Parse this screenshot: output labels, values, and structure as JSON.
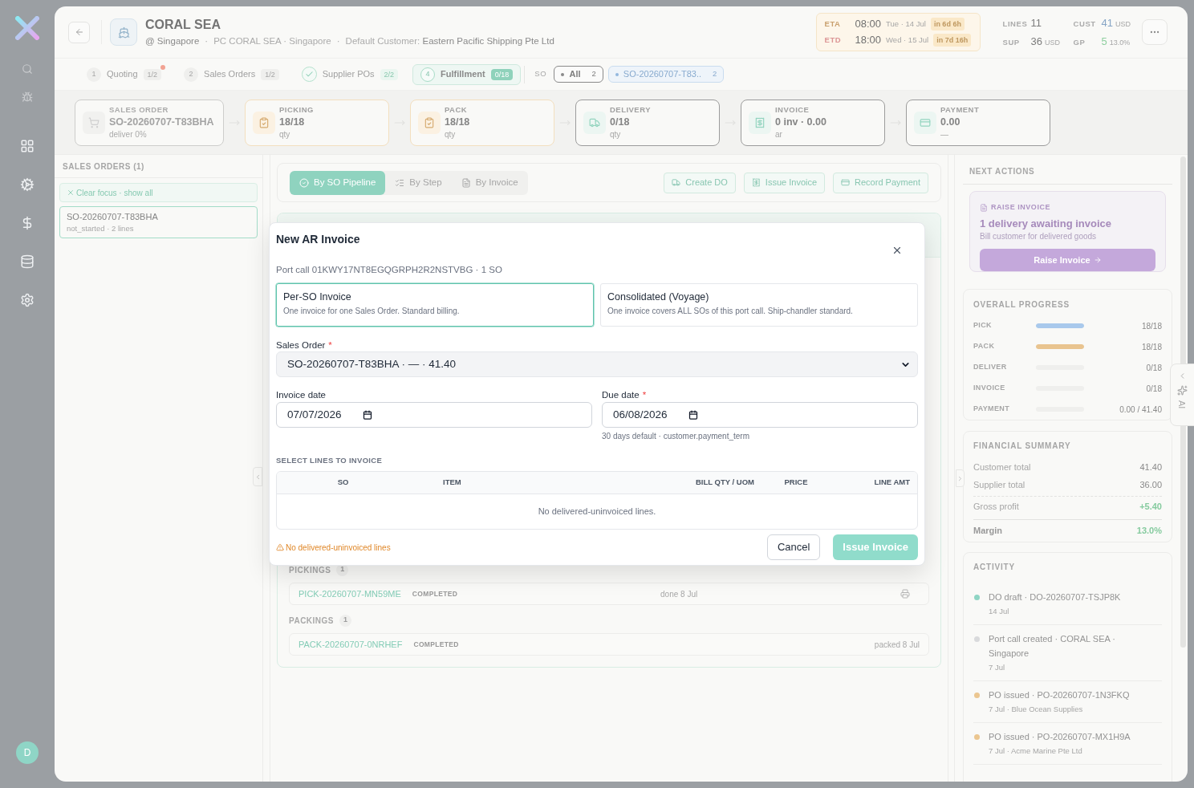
{
  "sidebar": {
    "avatar": "D"
  },
  "header": {
    "title": "CORAL SEA",
    "meta": [
      "@ Singapore",
      "PC CORAL SEA · Singapore"
    ],
    "separator": "·",
    "customer_label": "Default Customer:",
    "customer": "Eastern Pacific Shipping Pte Ltd"
  },
  "schedule": [
    {
      "kind": "eta",
      "label": "ETA",
      "time": "08:00",
      "date": "Tue · 14 Jul",
      "countdown": "in 6d 6h"
    },
    {
      "kind": "etd",
      "label": "ETD",
      "time": "18:00",
      "date": "Wed · 15 Jul",
      "countdown": "in 7d 16h"
    }
  ],
  "stats": [
    {
      "kind": "count",
      "label": "LINES",
      "value": "11"
    },
    {
      "kind": "revenue",
      "label": "CUST",
      "value": "41",
      "unit": "USD"
    },
    {
      "kind": "cost",
      "label": "SUP",
      "value": "36",
      "unit": "USD"
    },
    {
      "kind": "profit",
      "label": "GP",
      "value": "5",
      "unit": "13.0%"
    }
  ],
  "steps": [
    {
      "number": "1",
      "label": "Quoting",
      "count": "1/2",
      "alert": true,
      "done": false,
      "selected": false
    },
    {
      "number": "2",
      "label": "Sales Orders",
      "count": "1/2",
      "alert": false,
      "done": false,
      "selected": false
    },
    {
      "label": "Supplier POs",
      "count": "2/2",
      "alert": false,
      "done": true,
      "selected": false
    },
    {
      "number": "4",
      "label": "Fulfillment",
      "count": "0/18",
      "alert": false,
      "done": false,
      "selected": true
    }
  ],
  "so_filter": {
    "label": "SO",
    "options": [
      {
        "label": "All",
        "count": "2",
        "selected": true
      },
      {
        "label": "SO-20260707-T83..",
        "count": "2",
        "selected": false
      }
    ]
  },
  "stages": [
    {
      "kind": "sales_order",
      "disabled": true,
      "done": false,
      "label": "SALES ORDER",
      "value": "SO-20260707-T83BHA",
      "sub": "deliver 0%"
    },
    {
      "kind": "picking",
      "disabled": false,
      "done": true,
      "label": "PICKING",
      "value": "18/18",
      "sub": "qty"
    },
    {
      "kind": "pack",
      "disabled": false,
      "done": true,
      "label": "PACK",
      "value": "18/18",
      "sub": "qty"
    },
    {
      "kind": "delivery",
      "disabled": false,
      "done": false,
      "label": "DELIVERY",
      "value": "0/18",
      "sub": "qty"
    },
    {
      "kind": "invoice",
      "disabled": false,
      "done": false,
      "label": "INVOICE",
      "value": "0 inv · 0.00",
      "sub": "ar"
    },
    {
      "kind": "payment",
      "disabled": false,
      "done": false,
      "label": "PAYMENT",
      "value": "0.00",
      "sub": "—"
    }
  ],
  "sales_orders": {
    "title": "SALES ORDERS (1)",
    "clear_focus": "Clear focus · show all",
    "items": [
      {
        "id": "SO-20260707-T83BHA",
        "meta": "not_started · 2 lines",
        "selected": true
      }
    ]
  },
  "views": [
    {
      "kind": "pipeline",
      "label": "By SO Pipeline",
      "selected": true
    },
    {
      "kind": "step",
      "label": "By Step",
      "selected": false
    },
    {
      "kind": "invoice",
      "label": "By Invoice",
      "selected": false
    }
  ],
  "actions": [
    {
      "kind": "delivery",
      "label": "Create DO"
    },
    {
      "kind": "invoice",
      "label": "Issue Invoice"
    },
    {
      "kind": "payment",
      "label": "Record Payment"
    }
  ],
  "pickings": {
    "title": "PICKINGS",
    "count": "1",
    "rows": [
      {
        "ref": "PICK-20260707-MN59ME",
        "status": "COMPLETED",
        "note": "done 8 Jul",
        "printable": true
      }
    ]
  },
  "packings": {
    "title": "PACKINGS",
    "count": "1",
    "rows": [
      {
        "ref": "PACK-20260707-0NRHEF",
        "status": "COMPLETED",
        "note": "packed 8 Jul",
        "printable": false
      }
    ]
  },
  "dialog": {
    "title": "New AR Invoice",
    "subtitle": "Port call 01KWY17NT8EGQGRPH2R2NSTVBG · 1 SO",
    "modes": [
      {
        "title": "Per-SO Invoice",
        "description": "One invoice for one Sales Order. Standard billing.",
        "selected": true
      },
      {
        "title": "Consolidated (Voyage)",
        "description": "One invoice covers ALL SOs of this port call. Ship-chandler standard.",
        "selected": false
      }
    ],
    "sales_order": {
      "label": "Sales Order",
      "required_mark": "*",
      "value": "SO-20260707-T83BHA · — · 41.40"
    },
    "invoice_date": {
      "label": "Invoice date",
      "value": "07/07/2026"
    },
    "due_date": {
      "label": "Due date",
      "required_mark": "*",
      "value": "06/08/2026",
      "hint": "30 days default · customer.payment_term"
    },
    "lines": {
      "title": "SELECT LINES TO INVOICE",
      "columns": [
        "SO",
        "ITEM",
        "BILL QTY / UOM",
        "PRICE",
        "LINE AMT"
      ],
      "empty": "No delivered-uninvoiced lines."
    },
    "warning": "No delivered-uninvoiced lines",
    "buttons": [
      {
        "kind": "cancel",
        "label": "Cancel",
        "disabled": false
      },
      {
        "kind": "primary",
        "label": "Issue Invoice",
        "disabled": true
      }
    ]
  },
  "next_actions": {
    "title": "NEXT ACTIONS",
    "tag": "RAISE INVOICE",
    "headline": "1 delivery awaiting invoice",
    "description": "Bill customer for delivered goods",
    "button": "Raise Invoice"
  },
  "progress": {
    "title": "OVERALL PROGRESS",
    "rows": [
      {
        "label": "PICK",
        "level": 1,
        "color": "#a9c9ec",
        "reading": "18/18"
      },
      {
        "label": "PACK",
        "level": 1,
        "color": "#e9c48f",
        "reading": "18/18"
      },
      {
        "label": "DELIVER",
        "level": 0,
        "reading": "0/18"
      },
      {
        "label": "INVOICE",
        "level": 0,
        "reading": "0/18"
      },
      {
        "label": "PAYMENT",
        "level": 0,
        "reading": "0.00 / 41.40"
      }
    ]
  },
  "financial_summary": {
    "title": "FINANCIAL SUMMARY",
    "rows": [
      {
        "kind": "plain",
        "label": "Customer total",
        "value": "41.40"
      },
      {
        "kind": "plain",
        "label": "Supplier total",
        "value": "36.00"
      },
      {
        "kind": "profit",
        "label": "Gross profit",
        "value": "+5.40"
      },
      {
        "kind": "margin",
        "label": "Margin",
        "value": "13.0%"
      }
    ]
  },
  "activity": {
    "title": "ACTIVITY",
    "items": [
      {
        "text": "DO draft · DO-20260707-TSJP8K",
        "meta": "14 Jul",
        "color": "#8fd5c4"
      },
      {
        "text": "Port call created · CORAL SEA · Singapore",
        "meta": "7 Jul",
        "color": "#d9dadc"
      },
      {
        "text": "PO issued · PO-20260707-1N3FKQ",
        "meta": "7 Jul · Blue Ocean Supplies",
        "color": "#ebc690"
      },
      {
        "text": "PO issued · PO-20260707-MX1H9A",
        "meta": "7 Jul · Acme Marine Pte Ltd",
        "color": "#ebc690"
      }
    ]
  },
  "ai_tab": {
    "label": "AI"
  }
}
